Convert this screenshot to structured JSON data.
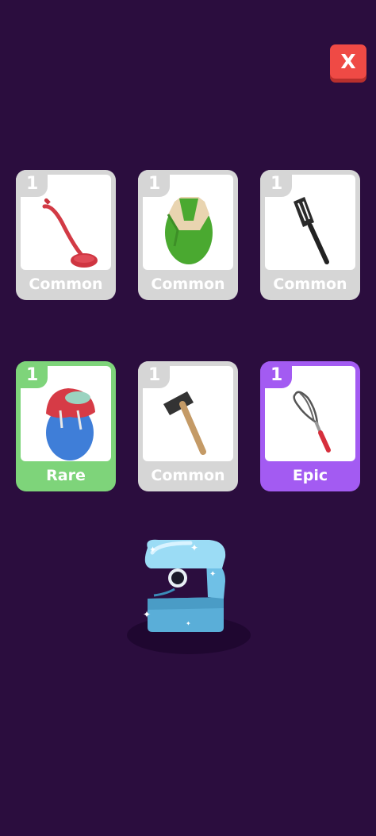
{
  "close_button": {
    "label": "X"
  },
  "colors": {
    "background": "#2b0d3e",
    "common": "#d6d6d6",
    "rare": "#7ed47a",
    "epic": "#a35bf2",
    "close": "#ef4a45"
  },
  "cards": [
    {
      "count": "1",
      "rarity": "Common",
      "item": "ladle-icon"
    },
    {
      "count": "1",
      "rarity": "Common",
      "item": "green-apron-icon"
    },
    {
      "count": "1",
      "rarity": "Common",
      "item": "spatula-icon"
    },
    {
      "count": "1",
      "rarity": "Rare",
      "item": "hoodie-icon"
    },
    {
      "count": "1",
      "rarity": "Common",
      "item": "hammer-icon"
    },
    {
      "count": "1",
      "rarity": "Epic",
      "item": "whisk-icon"
    }
  ],
  "chest": {
    "state": "open",
    "icon": "treasure-chest-icon"
  }
}
